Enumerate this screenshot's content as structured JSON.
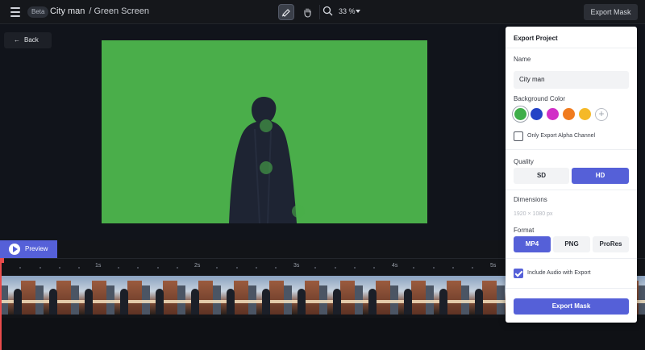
{
  "topbar": {
    "badge": "Beta",
    "project_name": "City man",
    "page_name": "/ Green Screen",
    "zoom": "33 %",
    "export_mask_label": "Export Mask"
  },
  "stage": {
    "back_label": "Back",
    "background_color": "#4aae4a"
  },
  "timeline": {
    "preview_label": "Preview",
    "ticks": [
      "1s",
      "2s",
      "3s",
      "4s",
      "5s"
    ]
  },
  "export_panel": {
    "title": "Export Project",
    "name_label": "Name",
    "name_value": "City man",
    "bg_label": "Background Color",
    "swatches": [
      "#3fae49",
      "#2443c6",
      "#d12fc7",
      "#f07b1e",
      "#f5b928"
    ],
    "alpha_label": "Only Export Alpha Channel",
    "alpha_checked": false,
    "quality_label": "Quality",
    "quality_options": [
      "SD",
      "HD"
    ],
    "quality_selected": "HD",
    "dimensions_label": "Dimensions",
    "dimensions_value": "1920 × 1080 px",
    "format_label": "Format",
    "format_options": [
      "MP4",
      "PNG",
      "ProRes"
    ],
    "format_selected": "MP4",
    "audio_label": "Include Audio with Export",
    "audio_checked": true,
    "export_button": "Export Mask"
  },
  "colors": {
    "accent": "#5560d8",
    "playhead": "#e94b4b"
  }
}
